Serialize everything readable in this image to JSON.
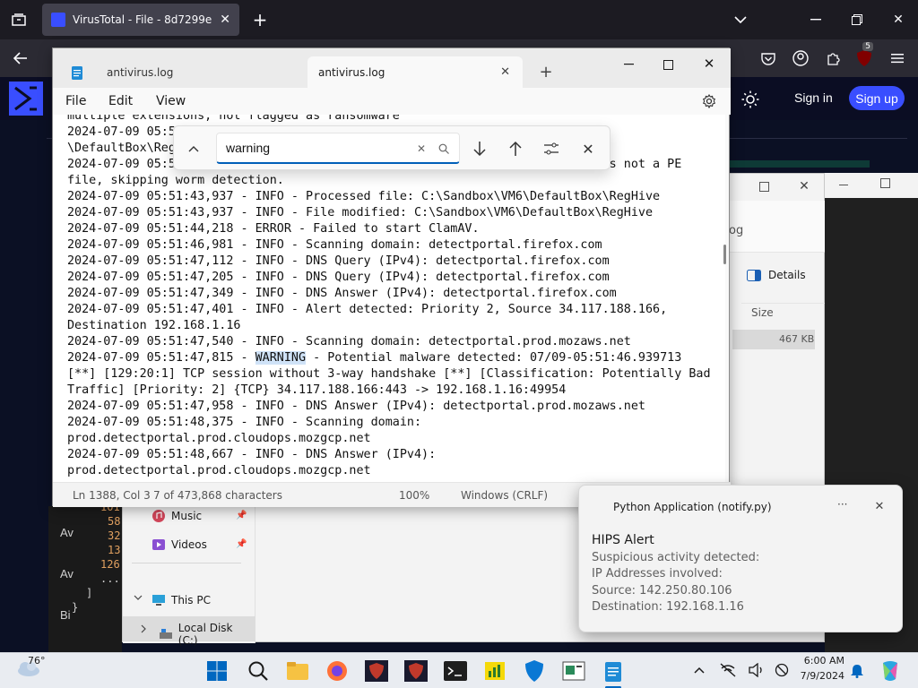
{
  "browser": {
    "tab_title": "VirusTotal - File - 8d7299e5a8a",
    "extension_badge": "5",
    "sign_in": "Sign in",
    "sign_up": "Sign up"
  },
  "background": {
    "left_labels": [
      "Av",
      "Av",
      "Bi"
    ],
    "numbers": [
      "101",
      "58",
      "32",
      "13",
      "126"
    ],
    "ellipsis": "...",
    "bracket": "]",
    "brace": "}"
  },
  "explorer": {
    "partial_text": "og",
    "details_label": "Details",
    "size_header": "Size",
    "file_size": "467 KB",
    "nav": [
      {
        "label": "Music",
        "icon": "music-icon"
      },
      {
        "label": "Videos",
        "icon": "videos-icon"
      },
      {
        "label": "This PC",
        "icon": "pc-icon"
      },
      {
        "label": "Local Disk (C:)",
        "icon": "disk-icon"
      }
    ]
  },
  "notepad": {
    "tabs": [
      "antivirus.log",
      "antivirus.log"
    ],
    "menu": [
      "File",
      "Edit",
      "View"
    ],
    "find": {
      "value": "warning",
      "placeholder": "Find"
    },
    "lines": [
      "multiple extensions, not flagged as ransomware",
      "2024-07-09 05:51:43,936 - INFO - Processed file: C:\\Sandbox\\VM6",
      "\\DefaultBox\\RegHive",
      "2024-07-09 05:51:43,936 - INFO - File  C:\\Sandbox\\VM6\\DefaultBox\\RegHive  is not a PE",
      "file, skipping worm detection.",
      "2024-07-09 05:51:43,937 - INFO - Processed file: C:\\Sandbox\\VM6\\DefaultBox\\RegHive",
      "2024-07-09 05:51:43,937 - INFO - File modified: C:\\Sandbox\\VM6\\DefaultBox\\RegHive",
      "2024-07-09 05:51:44,218 - ERROR - Failed to start ClamAV.",
      "2024-07-09 05:51:46,981 - INFO - Scanning domain: detectportal.firefox.com",
      "2024-07-09 05:51:47,112 - INFO - DNS Query (IPv4): detectportal.firefox.com",
      "2024-07-09 05:51:47,205 - INFO - DNS Query (IPv4): detectportal.firefox.com",
      "2024-07-09 05:51:47,349 - INFO - DNS Answer (IPv4): detectportal.firefox.com",
      "2024-07-09 05:51:47,401 - INFO - Alert detected: Priority 2, Source 34.117.188.166,",
      "Destination 192.168.1.16",
      "2024-07-09 05:51:47,540 - INFO - Scanning domain: detectportal.prod.mozaws.net",
      {
        "before": "2024-07-09 05:51:47,815 - ",
        "match": "WARNING",
        "after": " - Potential malware detected: 07/09-05:51:46.939713"
      },
      "[**] [129:20:1] TCP session without 3-way handshake [**] [Classification: Potentially Bad",
      "Traffic] [Priority: 2] {TCP} 34.117.188.166:443 -> 192.168.1.16:49954",
      "2024-07-09 05:51:47,958 - INFO - DNS Answer (IPv4): detectportal.prod.mozaws.net",
      "2024-07-09 05:51:48,375 - INFO - Scanning domain:",
      "prod.detectportal.prod.cloudops.mozgcp.net",
      "2024-07-09 05:51:48,667 - INFO - DNS Answer (IPv4):",
      "prod.detectportal.prod.cloudops.mozgcp.net"
    ],
    "status": {
      "position": "Ln 1388, Col 3",
      "chars": "7 of 473,868 characters",
      "zoom": "100%",
      "eol": "Windows (CRLF)"
    }
  },
  "toast": {
    "app": "Python Application (notify.py)",
    "more": "···",
    "title": "HIPS Alert",
    "body": [
      "Suspicious activity detected:",
      "IP Addresses involved:",
      "Source: 142.250.80.106",
      "Destination: 192.168.1.16"
    ]
  },
  "taskbar": {
    "weather_temp": "76°",
    "time": "6:00 AM",
    "date": "7/9/2024",
    "apps": [
      "start-icon",
      "search-icon",
      "file-explorer-icon",
      "firefox-icon",
      "shield-app-icon",
      "shield-app-icon",
      "terminal-icon",
      "chart-app-icon",
      "defender-icon",
      "notepad-app-icon",
      "notepad-icon"
    ]
  }
}
